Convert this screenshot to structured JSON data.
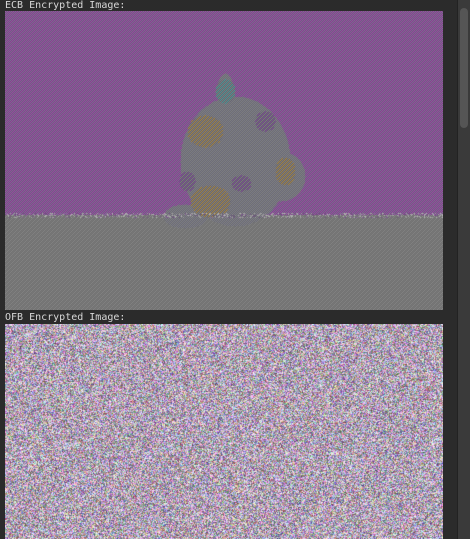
{
  "output": {
    "ecb": {
      "label": "ECB Encrypted Image:",
      "pattern_colors": {
        "sky_a": "#a35fae",
        "sky_b": "#6e3f7a",
        "sky_c": "#8b7aa0",
        "ground_a": "#7d7d7d",
        "ground_b": "#6a6a6a",
        "ground_c": "#8e8e8e",
        "cat_gray": "#8a8a94",
        "cat_orange": "#c89a3c",
        "cat_purple": "#8c4aa8",
        "cat_teal": "#4fb3b0"
      }
    },
    "ofb": {
      "label": "OFB Encrypted Image:",
      "noise_palette": [
        "#e04a7a",
        "#4ac48c",
        "#5a6ae0",
        "#d8c048",
        "#8c8c8c",
        "#b05ac8",
        "#48b8c8",
        "#6a6a6a",
        "#c87048"
      ]
    }
  }
}
